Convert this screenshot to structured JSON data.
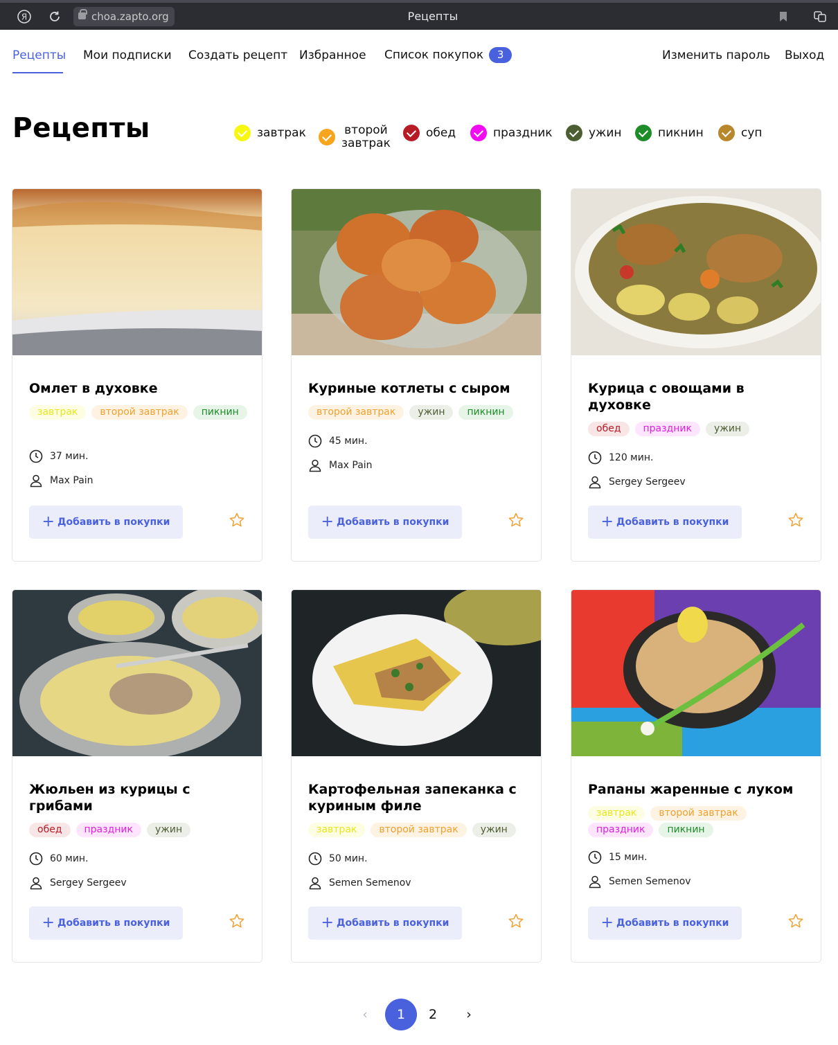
{
  "browser": {
    "url": "choa.zapto.org",
    "tab_title": "Рецепты"
  },
  "nav": {
    "items": [
      {
        "label": "Рецепты",
        "active": true
      },
      {
        "label": "Мои подписки"
      },
      {
        "label": "Создать рецепт"
      },
      {
        "label": "Избранное"
      },
      {
        "label": "Список покупок"
      }
    ],
    "cart_count": "3",
    "change_password": "Изменить пароль",
    "logout": "Выход"
  },
  "page": {
    "title": "Рецепты"
  },
  "filters": [
    {
      "label": "завтрак",
      "color": "#f7f711"
    },
    {
      "label_line1": "второй",
      "label_line2": "завтрак",
      "color": "#f7a51c"
    },
    {
      "label": "обед",
      "color": "#b71b26"
    },
    {
      "label": "праздник",
      "color": "#f20cf2"
    },
    {
      "label": "ужин",
      "color": "#4d5e33"
    },
    {
      "label": "пикнин",
      "color": "#1e8c29"
    },
    {
      "label": "суп",
      "color": "#b8862b"
    }
  ],
  "tag_styles": {
    "завтрак": {
      "bg": "#fdfde4",
      "fg": "#e7e71c"
    },
    "второй завтрак": {
      "bg": "#fef3e2",
      "fg": "#f0a030"
    },
    "пикнин": {
      "bg": "#e7f4e8",
      "fg": "#1e8c29"
    },
    "ужин": {
      "bg": "#ecefe8",
      "fg": "#4d5e33"
    },
    "обед": {
      "bg": "#f8e6e7",
      "fg": "#b71b26"
    },
    "праздник": {
      "bg": "#fde6fd",
      "fg": "#e01fe0"
    }
  },
  "recipes": [
    {
      "title": "Омлет в духовке",
      "tags": [
        "завтрак",
        "второй завтрак",
        "пикнин"
      ],
      "time": "37 мин.",
      "author": "Max Pain",
      "add_label": "Добавить в покупки"
    },
    {
      "title": "Куриные котлеты с сыром",
      "tags": [
        "второй завтрак",
        "ужин",
        "пикнин"
      ],
      "time": "45 мин.",
      "author": "Max Pain",
      "add_label": "Добавить в покупки"
    },
    {
      "title": "Курица с овощами в духовке",
      "tags": [
        "обед",
        "праздник",
        "ужин"
      ],
      "time": "120 мин.",
      "author": "Sergey Sergeev",
      "add_label": "Добавить в покупки"
    },
    {
      "title": "Жюльен из курицы с грибами",
      "tags": [
        "обед",
        "праздник",
        "ужин"
      ],
      "time": "60 мин.",
      "author": "Sergey Sergeev",
      "add_label": "Добавить в покупки"
    },
    {
      "title": "Картофельная запеканка с куриным филе",
      "tags": [
        "завтрак",
        "второй завтрак",
        "ужин"
      ],
      "time": "50 мин.",
      "author": "Semen Semenov",
      "add_label": "Добавить в покупки"
    },
    {
      "title": "Рапаны жаренные с луком",
      "tags": [
        "завтрак",
        "второй завтрак",
        "праздник",
        "пикнин"
      ],
      "time": "15 мин.",
      "author": "Semen Semenov",
      "add_label": "Добавить в покупки"
    }
  ],
  "pagination": {
    "prev": "‹",
    "pages": [
      "1",
      "2"
    ],
    "current": "1",
    "next": "›"
  }
}
